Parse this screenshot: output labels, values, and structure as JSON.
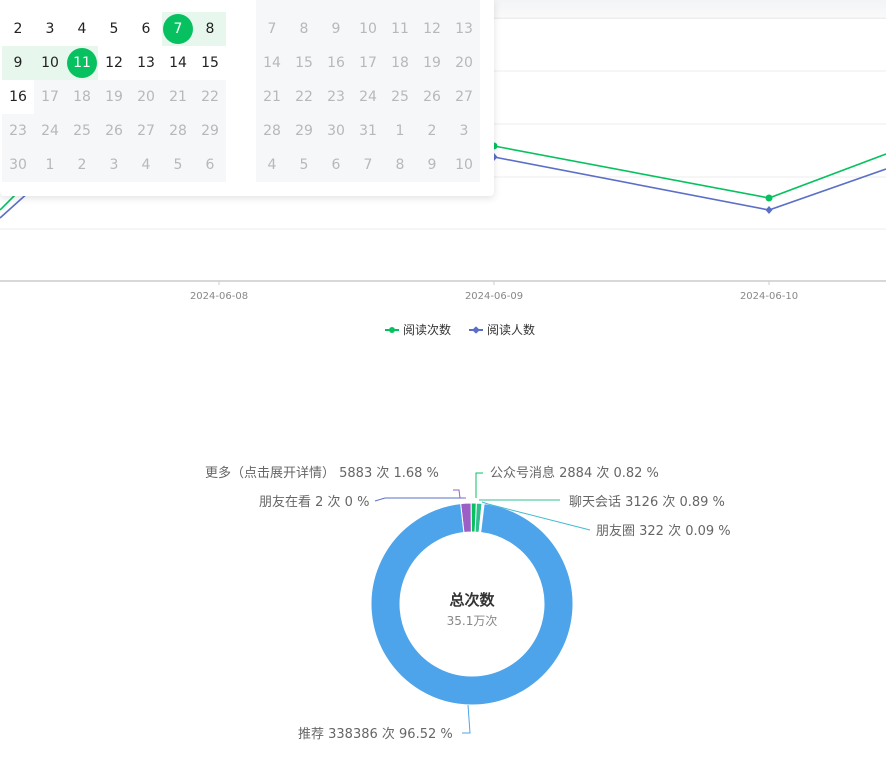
{
  "calendar": {
    "left_month_weeks": [
      [
        "2",
        "3",
        "4",
        "5",
        "6",
        "7",
        "8"
      ],
      [
        "9",
        "10",
        "11",
        "12",
        "13",
        "14",
        "15"
      ],
      [
        "16",
        "17",
        "18",
        "19",
        "20",
        "21",
        "22"
      ],
      [
        "23",
        "24",
        "25",
        "26",
        "27",
        "28",
        "29"
      ],
      [
        "30",
        "1",
        "2",
        "3",
        "4",
        "5",
        "6"
      ]
    ],
    "right_month_weeks": [
      [
        "7",
        "8",
        "9",
        "10",
        "11",
        "12",
        "13"
      ],
      [
        "14",
        "15",
        "16",
        "17",
        "18",
        "19",
        "20"
      ],
      [
        "21",
        "22",
        "23",
        "24",
        "25",
        "26",
        "27"
      ],
      [
        "28",
        "29",
        "30",
        "31",
        "1",
        "2",
        "3"
      ],
      [
        "4",
        "5",
        "6",
        "7",
        "8",
        "9",
        "10"
      ]
    ],
    "range_start": "7",
    "range_end": "11"
  },
  "line_chart": {
    "x_labels": [
      "2024-06-08",
      "2024-06-09",
      "2024-06-10"
    ],
    "legend": [
      {
        "name": "阅读次数",
        "color": "#07c160"
      },
      {
        "name": "阅读人数",
        "color": "#5b6fc7"
      }
    ]
  },
  "donut": {
    "title": "总次数",
    "subtitle": "35.1万次",
    "slices": [
      {
        "label": "推荐 338386 次 96.52 %",
        "value": 338386,
        "color": "#4da4ea"
      },
      {
        "label": "更多（点击展开详情） 5883 次 1.68 %",
        "value": 5883,
        "color": "#9b5fc5"
      },
      {
        "label": "公众号消息 2884 次 0.82 %",
        "value": 2884,
        "color": "#07c160"
      },
      {
        "label": "聊天会话 3126 次 0.89 %",
        "value": 3126,
        "color": "#2fbf8f"
      },
      {
        "label": "朋友圈 322 次 0.09 %",
        "value": 322,
        "color": "#3fbcd0"
      },
      {
        "label": "朋友在看 2 次 0 %",
        "value": 2,
        "color": "#5b6fc7"
      }
    ]
  }
}
